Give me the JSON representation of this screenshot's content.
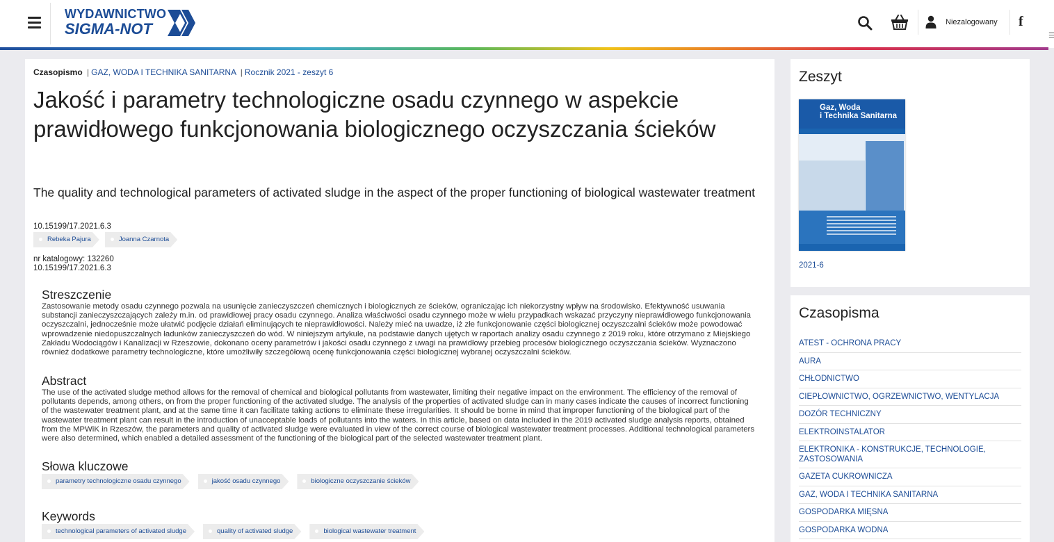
{
  "header": {
    "logo_line1": "WYDAWNICTWO",
    "logo_line2": "SIGMA-NOT",
    "user_label": "Niezalogowany",
    "icons": [
      "menu-icon",
      "search-icon",
      "cart-icon",
      "user-icon",
      "facebook-icon"
    ],
    "facebook_glyph": "f",
    "brand_color": "#1c4c96"
  },
  "article": {
    "breadcrumb": {
      "section": "Czasopismo",
      "separator": "|",
      "journal": "GAZ, WODA I TECHNIKA SANITARNA",
      "issue": "Rocznik 2021 - zeszyt 6"
    },
    "title": "Jakość i parametry technologiczne osadu czynnego w aspekcie prawidłowego funkcjonowania biologicznego oczyszczania ścieków",
    "subtitle": "The quality and technological parameters of activated sludge in the aspect of the proper functioning of biological wastewater treatment",
    "doi": "10.15199/17.2021.6.3",
    "authors": [
      "Rebeka Pajura",
      "Joanna Czarnota"
    ],
    "catalog_label": "nr katalogowy: 132260",
    "doi_repeat": "10.15199/17.2021.6.3",
    "abstract_pl_heading": "Streszczenie",
    "abstract_pl": "Zastosowanie metody osadu czynnego pozwala na usunięcie zanieczyszczeń chemicznych i biologicznych ze ścieków, ograniczając ich niekorzystny wpływ na środowisko. Efektywność usuwania substancji zanieczyszczających zależy m.in. od prawidłowej pracy osadu czynnego. Analiza właściwości osadu czynnego może w wielu przypadkach wskazać przyczyny nieprawidłowego funkcjonowania oczyszczalni, jednocześnie może ułatwić podjęcie działań eliminujących te nieprawidłowości. Należy mieć na uwadze, iż złe funkcjonowanie części biologicznej oczyszczalni ścieków może powodować wprowadzenie niedopuszczalnych ładunków zanieczyszczeń do wód. W niniejszym artykule, na podstawie danych ujętych w raportach analizy osadu czynnego z 2019 roku, które otrzymano z Miejskiego Zakładu Wodociągów i Kanalizacji w Rzeszowie, dokonano oceny parametrów i jakości osadu czynnego z uwagi na prawidłowy przebieg procesów biologicznego oczyszczania ścieków. Wyznaczono również dodatkowe parametry technologiczne, które umożliwiły szczegółową ocenę funkcjonowania części biologicznej wybranej oczyszczalni ścieków.",
    "abstract_en_heading": "Abstract",
    "abstract_en": "The use of the activated sludge method allows for the removal of chemical and biological pollutants from wastewater, limiting their negative impact on the environment. The efficiency of the removal of pollutants depends, among others, on from the proper functioning of the activated sludge. The analysis of the properties of activated sludge can in many cases indicate the causes of incorrect functioning of the wastewater treatment plant, and at the same time it can facilitate taking actions to eliminate these irregularities. It should be borne in mind that improper functioning of the biological part of the wastewater treatment plant can result in the introduction of unacceptable loads of pollutants into the waters. In this article, based on data included in the 2019 activated sludge analysis reports, obtained from the MPWiK in Rzeszów, the parameters and quality of activated sludge were evaluated in view of the correct course of biological wastewater treatment processes. Additional technological parameters were also determined, which enabled a detailed assessment of the functioning of the biological part of the selected wastewater treatment plant.",
    "keywords_pl_heading": "Słowa kluczowe",
    "keywords_pl": [
      "parametry technologiczne osadu czynnego",
      "jakość osadu czynnego",
      "biologiczne oczyszczanie ścieków"
    ],
    "keywords_en_heading": "Keywords",
    "keywords_en": [
      "technological parameters of activated sludge",
      "quality of activated sludge",
      "biological wastewater treatment"
    ]
  },
  "sidebar": {
    "issue_heading": "Zeszyt",
    "cover_title_line1": "Gaz, Woda",
    "cover_title_line2": "i Technika Sanitarna",
    "issue_link": "2021-6",
    "journals_heading": "Czasopisma",
    "journals": [
      "ATEST - OCHRONA PRACY",
      "AURA",
      "CHŁODNICTWO",
      "CIEPŁOWNICTWO, OGRZEWNICTWO, WENTYLACJA",
      "DOZÓR TECHNICZNY",
      "ELEKTROINSTALATOR",
      "ELEKTRONIKA - KONSTRUKCJE, TECHNOLOGIE, ZASTOSOWANIA",
      "GAZETA CUKROWNICZA",
      "GAZ, WODA I TECHNIKA SANITARNA",
      "GOSPODARKA MIĘSNA",
      "GOSPODARKA WODNA"
    ]
  }
}
